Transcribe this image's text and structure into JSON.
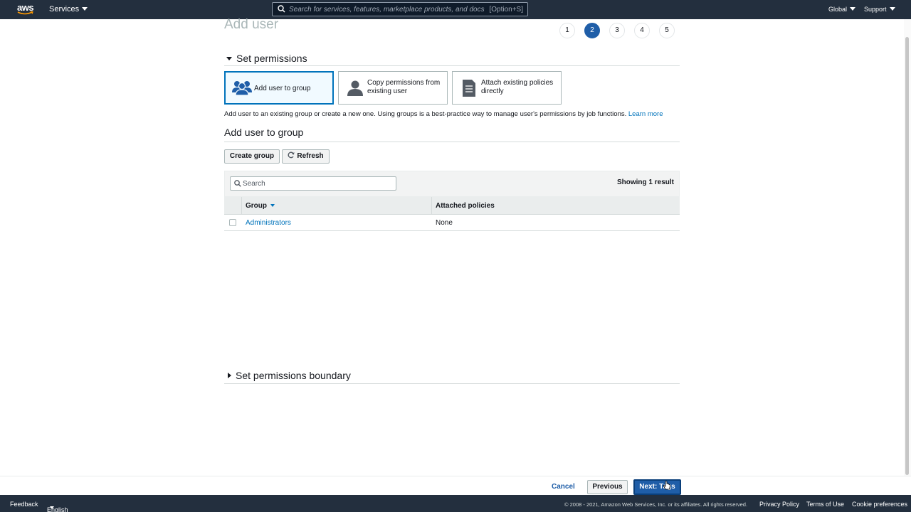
{
  "topnav": {
    "logo": "aws",
    "services": "Services",
    "search_placeholder": "Search for services, features, marketplace products, and docs",
    "search_shortcut": "[Option+S]",
    "region": "Global",
    "support": "Support"
  },
  "page": {
    "title": "Add user",
    "steps": [
      "1",
      "2",
      "3",
      "4",
      "5"
    ],
    "active_step": "2"
  },
  "permissions": {
    "heading": "Set permissions",
    "options": [
      {
        "label": "Add user to group",
        "icon": "group-icon",
        "selected": true
      },
      {
        "label": "Copy permissions from existing user",
        "icon": "user-icon",
        "selected": false
      },
      {
        "label": "Attach existing policies directly",
        "icon": "document-icon",
        "selected": false
      }
    ],
    "description": "Add user to an existing group or create a new one. Using groups is a best-practice way to manage user's permissions by job functions.",
    "learn_more": "Learn more"
  },
  "group": {
    "heading": "Add user to group",
    "create_button": "Create group",
    "refresh_button": "Refresh",
    "search_placeholder": "Search",
    "showing": "Showing 1 result",
    "columns": [
      "Group",
      "Attached policies"
    ],
    "rows": [
      {
        "group": "Administrators",
        "policies": "None"
      }
    ]
  },
  "boundary": {
    "heading": "Set permissions boundary"
  },
  "actions": {
    "cancel": "Cancel",
    "previous": "Previous",
    "next": "Next: Tags"
  },
  "footer": {
    "feedback": "Feedback",
    "language": "English (US)",
    "copyright": "© 2008 - 2021, Amazon Web Services, Inc. or its affiliates. All rights reserved.",
    "privacy": "Privacy Policy",
    "terms": "Terms of Use",
    "cookies": "Cookie preferences"
  },
  "colors": {
    "nav_bg": "#232f3e",
    "accent": "#0073bb",
    "primary_button": "#1f5ea8"
  }
}
